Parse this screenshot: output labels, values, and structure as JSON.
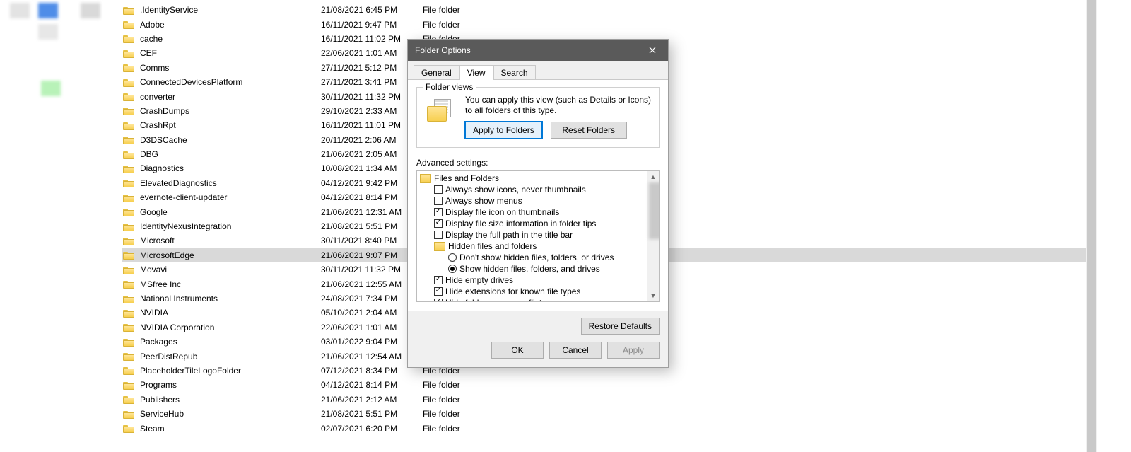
{
  "files": [
    {
      "name": ".IdentityService",
      "date": "21/08/2021 6:45 PM",
      "type": "File folder"
    },
    {
      "name": "Adobe",
      "date": "16/11/2021 9:47 PM",
      "type": "File folder"
    },
    {
      "name": "cache",
      "date": "16/11/2021 11:02 PM",
      "type": "File folder"
    },
    {
      "name": "CEF",
      "date": "22/06/2021 1:01 AM",
      "type": ""
    },
    {
      "name": "Comms",
      "date": "27/11/2021 5:12 PM",
      "type": ""
    },
    {
      "name": "ConnectedDevicesPlatform",
      "date": "27/11/2021 3:41 PM",
      "type": ""
    },
    {
      "name": "converter",
      "date": "30/11/2021 11:32 PM",
      "type": ""
    },
    {
      "name": "CrashDumps",
      "date": "29/10/2021 2:33 AM",
      "type": ""
    },
    {
      "name": "CrashRpt",
      "date": "16/11/2021 11:01 PM",
      "type": ""
    },
    {
      "name": "D3DSCache",
      "date": "20/11/2021 2:06 AM",
      "type": ""
    },
    {
      "name": "DBG",
      "date": "21/06/2021 2:05 AM",
      "type": ""
    },
    {
      "name": "Diagnostics",
      "date": "10/08/2021 1:34 AM",
      "type": ""
    },
    {
      "name": "ElevatedDiagnostics",
      "date": "04/12/2021 9:42 PM",
      "type": ""
    },
    {
      "name": "evernote-client-updater",
      "date": "04/12/2021 8:14 PM",
      "type": ""
    },
    {
      "name": "Google",
      "date": "21/06/2021 12:31 AM",
      "type": ""
    },
    {
      "name": "IdentityNexusIntegration",
      "date": "21/08/2021 5:51 PM",
      "type": ""
    },
    {
      "name": "Microsoft",
      "date": "30/11/2021 8:40 PM",
      "type": ""
    },
    {
      "name": "MicrosoftEdge",
      "date": "21/06/2021 9:07 PM",
      "type": ""
    },
    {
      "name": "Movavi",
      "date": "30/11/2021 11:32 PM",
      "type": ""
    },
    {
      "name": "MSfree Inc",
      "date": "21/06/2021 12:55 AM",
      "type": ""
    },
    {
      "name": "National Instruments",
      "date": "24/08/2021 7:34 PM",
      "type": ""
    },
    {
      "name": "NVIDIA",
      "date": "05/10/2021 2:04 AM",
      "type": ""
    },
    {
      "name": "NVIDIA Corporation",
      "date": "22/06/2021 1:01 AM",
      "type": ""
    },
    {
      "name": "Packages",
      "date": "03/01/2022 9:04 PM",
      "type": ""
    },
    {
      "name": "PeerDistRepub",
      "date": "21/06/2021 12:54 AM",
      "type": ""
    },
    {
      "name": "PlaceholderTileLogoFolder",
      "date": "07/12/2021 8:34 PM",
      "type": "File folder"
    },
    {
      "name": "Programs",
      "date": "04/12/2021 8:14 PM",
      "type": "File folder"
    },
    {
      "name": "Publishers",
      "date": "21/06/2021 2:12 AM",
      "type": "File folder"
    },
    {
      "name": "ServiceHub",
      "date": "21/08/2021 5:51 PM",
      "type": "File folder"
    },
    {
      "name": "Steam",
      "date": "02/07/2021 6:20 PM",
      "type": "File folder"
    }
  ],
  "selected_index": 17,
  "dialog": {
    "title": "Folder Options",
    "tabs": {
      "general": "General",
      "view": "View",
      "search": "Search"
    },
    "active_tab": "view",
    "folder_views": {
      "legend": "Folder views",
      "desc": "You can apply this view (such as Details or Icons) to all folders of this type.",
      "apply_btn": "Apply to Folders",
      "reset_btn": "Reset Folders"
    },
    "advanced": {
      "label": "Advanced settings:",
      "group_label": "Files and Folders",
      "items": [
        {
          "kind": "check",
          "checked": false,
          "label": "Always show icons, never thumbnails"
        },
        {
          "kind": "check",
          "checked": false,
          "label": "Always show menus"
        },
        {
          "kind": "check",
          "checked": true,
          "label": "Display file icon on thumbnails"
        },
        {
          "kind": "check",
          "checked": true,
          "label": "Display file size information in folder tips"
        },
        {
          "kind": "check",
          "checked": false,
          "label": "Display the full path in the title bar"
        },
        {
          "kind": "folder",
          "label": "Hidden files and folders"
        },
        {
          "kind": "radio",
          "selected": false,
          "indent": 2,
          "label": "Don't show hidden files, folders, or drives"
        },
        {
          "kind": "radio",
          "selected": true,
          "indent": 2,
          "label": "Show hidden files, folders, and drives"
        },
        {
          "kind": "check",
          "checked": true,
          "label": "Hide empty drives"
        },
        {
          "kind": "check",
          "checked": true,
          "label": "Hide extensions for known file types"
        },
        {
          "kind": "check",
          "checked": true,
          "label": "Hide folder merge conflicts"
        }
      ]
    },
    "restore_btn": "Restore Defaults",
    "ok_btn": "OK",
    "cancel_btn": "Cancel",
    "apply_btn": "Apply"
  }
}
